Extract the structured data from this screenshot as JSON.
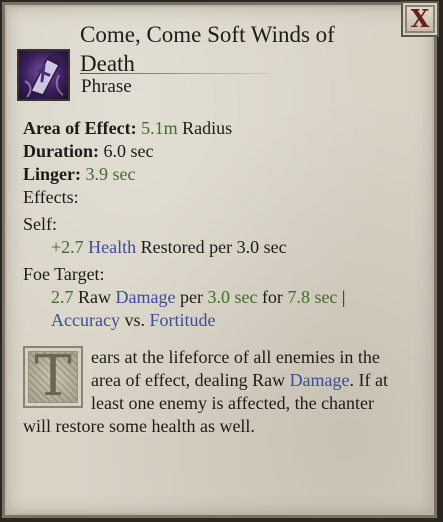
{
  "close_label": "X",
  "title": "Come, Come Soft Winds of Death",
  "subtitle": "Phrase",
  "stats": {
    "aoe_label": "Area of Effect:",
    "aoe_value": "5.1m",
    "aoe_unit": "Radius",
    "duration_label": "Duration:",
    "duration_value": "6.0 sec",
    "linger_label": "Linger:",
    "linger_value": "3.9 sec",
    "effects_label": "Effects:"
  },
  "self": {
    "label": "Self:",
    "amount": "+2.7",
    "stat": "Health",
    "rest": "Restored per 3.0 sec"
  },
  "foe": {
    "label": "Foe Target:",
    "amount": "2.7",
    "raw": "Raw",
    "damage": "Damage",
    "per": "per",
    "interval": "3.0 sec",
    "for": "for",
    "duration": "7.8 sec",
    "sep": "|",
    "accuracy": "Accuracy",
    "vs": "vs.",
    "defense": "Fortitude"
  },
  "description": {
    "dropcap": "T",
    "part1": "ears at the lifeforce of all enemies in the area of effect, dealing Raw",
    "link": "Damage",
    "part2": ". If at least one enemy is affected, the chanter will restore some health as well."
  },
  "colors": {
    "value_green": "#3f6e2a",
    "keyword_blue": "#3a4d99",
    "close_red": "#6b1f1a"
  },
  "icon": "purple-shroud-coffin-icon"
}
